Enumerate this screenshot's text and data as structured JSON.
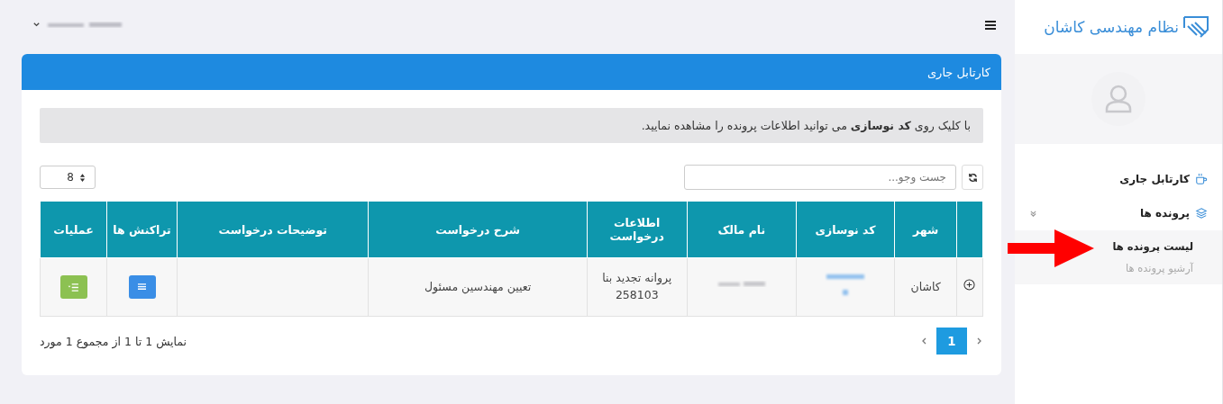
{
  "brand": {
    "title": "نظام مهندسی کاشان"
  },
  "sidebar": {
    "items": [
      {
        "label": "کارتابل جاری",
        "kind": "inbox"
      },
      {
        "label": "پرونده ها",
        "kind": "layers",
        "expanded": true,
        "children": [
          {
            "label": "لیست پرونده ها",
            "selected": true
          },
          {
            "label": "آرشیو پرونده ها",
            "selected": false
          }
        ]
      }
    ]
  },
  "card": {
    "title": "کارتابل جاری",
    "notice": "با کلیک روی **کد نوسازی** می توانید اطلاعات پرونده را مشاهده نمایید.",
    "search": {
      "placeholder": "جست وجو..."
    },
    "page_size": "8",
    "table": {
      "columns": [
        "شهر",
        "کد نوسازی",
        "نام مالک",
        "اطلاعات درخواست",
        "شرح درخواست",
        "توضیحات درخواست",
        "تراکنش ها",
        "عملیات"
      ],
      "rows": [
        {
          "city": "کاشان",
          "request_info": [
            "پروانه تجدید بنا",
            "258103"
          ],
          "request_summary": "تعیین مهندسین مسئول",
          "expanded": false
        }
      ]
    },
    "pagination": {
      "pages": [
        {
          "label": "1",
          "selected": true
        }
      ]
    },
    "summary": "نمایش 1 تا 1 از مجموع 1 مورد"
  }
}
